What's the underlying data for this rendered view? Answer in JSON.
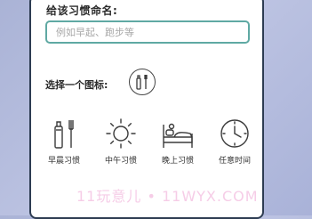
{
  "dialog": {
    "title": "给该习惯命名:",
    "name_input": {
      "value": "",
      "placeholder": "例如早起、跑步等"
    },
    "icon_picker": {
      "label": "选择一个图标:",
      "selected_icon": "toothbrush-toothpaste-icon",
      "options": [
        {
          "icon": "toothbrush-toothpaste-icon",
          "label": "早晨习惯"
        },
        {
          "icon": "sun-icon",
          "label": "中午习惯"
        },
        {
          "icon": "bed-icon",
          "label": "晚上习惯"
        },
        {
          "icon": "clock-icon",
          "label": "任意时间"
        }
      ]
    }
  },
  "watermark": "11玩意儿 • 11WYX.COM",
  "colors": {
    "input_border": "#5fa9a3",
    "dialog_border": "#2d3c52",
    "icon_stroke": "#3a3a3a"
  }
}
